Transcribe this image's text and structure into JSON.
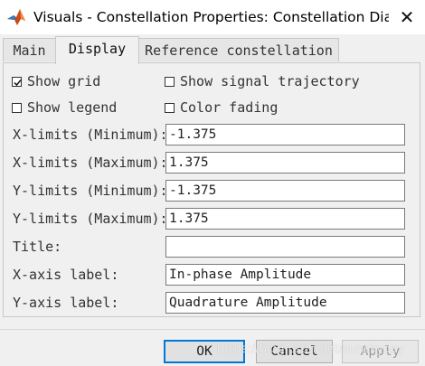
{
  "window": {
    "title": "Visuals - Constellation Properties: Constellation Diagram",
    "app_icon": "matlab-logo-icon",
    "close_glyph": "✕"
  },
  "tabs": [
    {
      "label": "Main",
      "active": false
    },
    {
      "label": "Display",
      "active": true
    },
    {
      "label": "Reference constellation",
      "active": false
    }
  ],
  "options": {
    "show_grid": {
      "label": "Show grid",
      "checked": true
    },
    "show_signal_trajectory": {
      "label": "Show signal trajectory",
      "checked": false
    },
    "show_legend": {
      "label": "Show legend",
      "checked": false
    },
    "color_fading": {
      "label": "Color fading",
      "checked": false
    }
  },
  "fields": [
    {
      "label": "X-limits (Minimum):",
      "value": "-1.375"
    },
    {
      "label": "X-limits (Maximum):",
      "value": "1.375"
    },
    {
      "label": "Y-limits (Minimum):",
      "value": "-1.375"
    },
    {
      "label": "Y-limits (Maximum):",
      "value": "1.375"
    },
    {
      "label": "Title:",
      "value": ""
    },
    {
      "label": "X-axis label:",
      "value": "In-phase Amplitude"
    },
    {
      "label": "Y-axis label:",
      "value": "Quadrature Amplitude"
    }
  ],
  "buttons": {
    "ok": "OK",
    "cancel": "Cancel",
    "apply": "Apply"
  },
  "watermark": "https://blog.csdn.net/sunskyday",
  "colors": {
    "accent": "#0078d7",
    "matlab_orange": "#e16737"
  }
}
